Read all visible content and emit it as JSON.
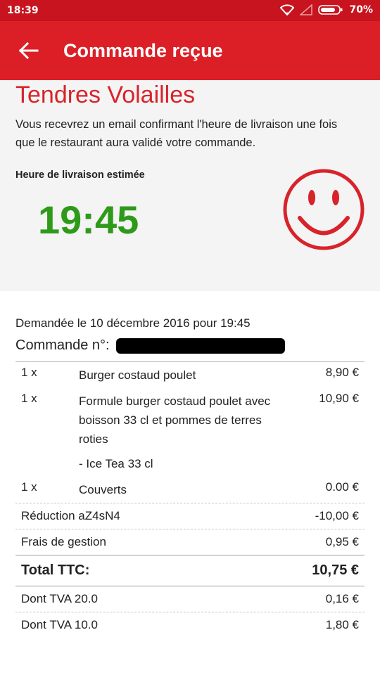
{
  "status_bar": {
    "time": "18:39",
    "battery": "70%"
  },
  "app_bar": {
    "title": "Commande reçue"
  },
  "hero": {
    "restaurant": "Tendres Volailles",
    "description": "Vous recevrez un email confirmant l'heure de livraison une fois que le restaurant aura validé votre commande.",
    "eta_label": "Heure de livraison estimée",
    "eta_time": "19:45"
  },
  "order": {
    "requested": "Demandée le 10 décembre 2016 pour 19:45",
    "number_label": "Commande n°:",
    "items": [
      {
        "qty": "1 x",
        "name": "Burger costaud poulet",
        "price": "8,90 €"
      },
      {
        "qty": "1 x",
        "name": "Formule burger costaud poulet avec boisson 33 cl et pommes de terres roties",
        "price": "10,90 €",
        "option": "- Ice Tea 33 cl"
      },
      {
        "qty": "1 x",
        "name": "Couverts",
        "price": "0.00 €"
      }
    ],
    "discount": {
      "label": "Réduction aZ4sN4",
      "value": "-10,00 €"
    },
    "fees": {
      "label": "Frais de gestion",
      "value": "0,95 €"
    },
    "total": {
      "label": "Total TTC:",
      "value": "10,75 €"
    },
    "tva": [
      {
        "label": "Dont TVA 20.0",
        "value": "0,16 €"
      },
      {
        "label": "Dont TVA 10.0",
        "value": "1,80 €"
      }
    ]
  },
  "colors": {
    "primary": "#dc1f26",
    "status": "#c8141e",
    "eta": "#2e9a1a"
  }
}
